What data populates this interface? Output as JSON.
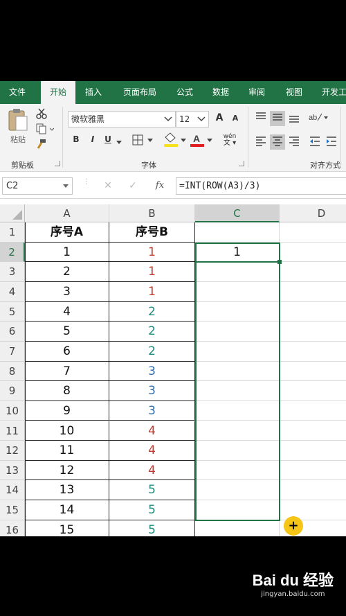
{
  "ribbon": {
    "tabs": [
      "文件",
      "开始",
      "插入",
      "页面布局",
      "公式",
      "数据",
      "审阅",
      "视图",
      "开发工"
    ],
    "active_tab": "开始",
    "clipboard": {
      "paste_label": "粘贴",
      "group_label": "剪贴板"
    },
    "font": {
      "name": "微软雅黑",
      "size": "12",
      "group_label": "字体",
      "bold": "B",
      "italic": "I",
      "underline": "U",
      "grow": "A",
      "shrink": "A",
      "wen": "wén"
    },
    "alignment": {
      "group_label": "对齐方式"
    }
  },
  "formula_bar": {
    "name_box": "C2",
    "cancel": "✕",
    "enter": "✓",
    "fx": "fx",
    "formula": "=INT(ROW(A3)/3)"
  },
  "grid": {
    "columns": [
      "A",
      "B",
      "C",
      "D"
    ],
    "selected_column": "C",
    "headers": {
      "A": "序号A",
      "B": "序号B"
    },
    "rows": [
      {
        "row": "1"
      },
      {
        "row": "2",
        "a": "1",
        "b": "1",
        "c": "1"
      },
      {
        "row": "3",
        "a": "2",
        "b": "1"
      },
      {
        "row": "4",
        "a": "3",
        "b": "1"
      },
      {
        "row": "5",
        "a": "4",
        "b": "2"
      },
      {
        "row": "6",
        "a": "5",
        "b": "2"
      },
      {
        "row": "7",
        "a": "6",
        "b": "2"
      },
      {
        "row": "8",
        "a": "7",
        "b": "3"
      },
      {
        "row": "9",
        "a": "8",
        "b": "3"
      },
      {
        "row": "10",
        "a": "9",
        "b": "3"
      },
      {
        "row": "11",
        "a": "10",
        "b": "4"
      },
      {
        "row": "12",
        "a": "11",
        "b": "4"
      },
      {
        "row": "13",
        "a": "12",
        "b": "4"
      },
      {
        "row": "14",
        "a": "13",
        "b": "5"
      },
      {
        "row": "15",
        "a": "14",
        "b": "5"
      },
      {
        "row": "16",
        "a": "15",
        "b": "5"
      }
    ],
    "b_colors": {
      "1": "red",
      "2": "teal",
      "3": "blue",
      "4": "red",
      "5": "teal"
    }
  },
  "overlay": {
    "cursor_symbol": "+",
    "watermark_logo": "Bai du 经验",
    "watermark_site": "jingyan.baidu.com"
  },
  "colors": {
    "accent": "#217346"
  }
}
